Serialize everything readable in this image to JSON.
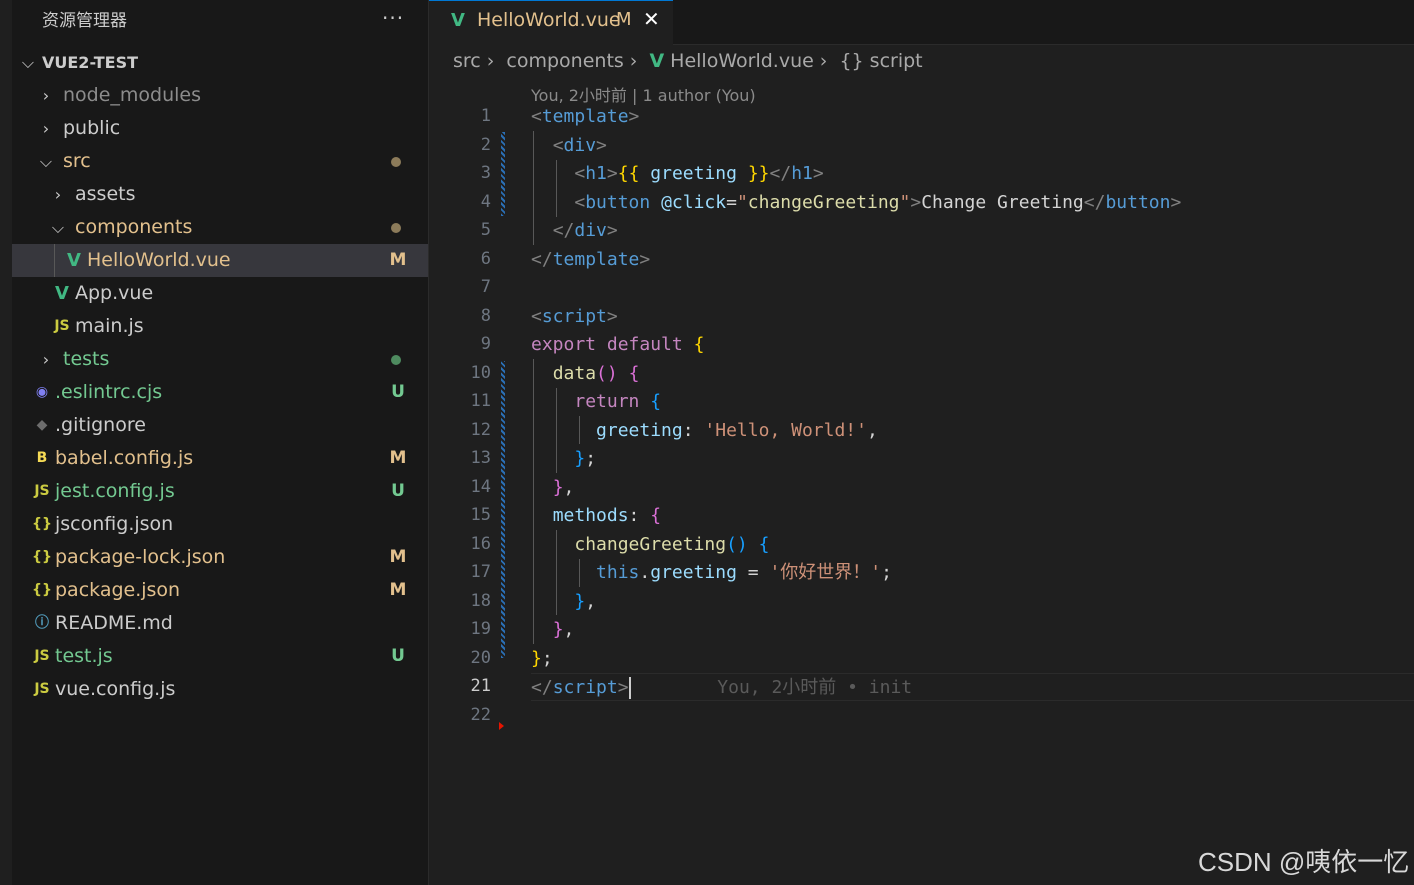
{
  "explorer": {
    "title": "资源管理器",
    "more": "···",
    "project": "VUE2-TEST",
    "items": [
      {
        "label": "node_modules",
        "kind": "folder",
        "state": "collapsed",
        "color": "#8c8c8c",
        "icon": "chevron-right-icon"
      },
      {
        "label": "public",
        "kind": "folder",
        "state": "collapsed",
        "color": "#cccccc",
        "icon": "chevron-right-icon"
      },
      {
        "label": "src",
        "kind": "folder",
        "state": "expanded",
        "color": "#e2c08d",
        "icon": "chevron-down-icon",
        "dot": "#8c7b5a"
      },
      {
        "label": "assets",
        "kind": "folder",
        "state": "collapsed",
        "color": "#cccccc",
        "icon": "chevron-right-icon"
      },
      {
        "label": "components",
        "kind": "folder",
        "state": "expanded",
        "color": "#e2c08d",
        "icon": "chevron-down-icon",
        "dot": "#8c7b5a"
      },
      {
        "label": "HelloWorld.vue",
        "kind": "file",
        "color": "#e2c08d",
        "icon": "vue-icon",
        "badge": "M",
        "badgeColor": "#e2c08d"
      },
      {
        "label": "App.vue",
        "kind": "file",
        "color": "#cccccc",
        "icon": "vue-icon"
      },
      {
        "label": "main.js",
        "kind": "file",
        "color": "#cccccc",
        "icon": "js-icon"
      },
      {
        "label": "tests",
        "kind": "folder",
        "state": "collapsed",
        "color": "#73c991",
        "icon": "chevron-right-icon",
        "dot": "#4e8b5f"
      },
      {
        "label": ".eslintrc.cjs",
        "kind": "file",
        "color": "#73c991",
        "icon": "eslint-icon",
        "badge": "U",
        "badgeColor": "#73c991"
      },
      {
        "label": ".gitignore",
        "kind": "file",
        "color": "#cccccc",
        "icon": "git-icon"
      },
      {
        "label": "babel.config.js",
        "kind": "file",
        "color": "#e2c08d",
        "icon": "babel-icon",
        "badge": "M",
        "badgeColor": "#e2c08d"
      },
      {
        "label": "jest.config.js",
        "kind": "file",
        "color": "#73c991",
        "icon": "js-icon",
        "badge": "U",
        "badgeColor": "#73c991"
      },
      {
        "label": "jsconfig.json",
        "kind": "file",
        "color": "#cccccc",
        "icon": "json-icon"
      },
      {
        "label": "package-lock.json",
        "kind": "file",
        "color": "#e2c08d",
        "icon": "json-icon",
        "badge": "M",
        "badgeColor": "#e2c08d"
      },
      {
        "label": "package.json",
        "kind": "file",
        "color": "#e2c08d",
        "icon": "json-icon",
        "badge": "M",
        "badgeColor": "#e2c08d"
      },
      {
        "label": "README.md",
        "kind": "file",
        "color": "#cccccc",
        "icon": "info-icon"
      },
      {
        "label": "test.js",
        "kind": "file",
        "color": "#73c991",
        "icon": "js-icon",
        "badge": "U",
        "badgeColor": "#73c991"
      },
      {
        "label": "vue.config.js",
        "kind": "file",
        "color": "#cccccc",
        "icon": "js-icon"
      }
    ]
  },
  "tab": {
    "name": "HelloWorld.vue",
    "status": "M",
    "close": "✕"
  },
  "breadcrumb": {
    "parts": [
      "src",
      "components",
      "HelloWorld.vue",
      "{} script"
    ]
  },
  "blame": {
    "header": "You, 2小时前 | 1 author (You)",
    "inline": "You, 2小时前 • init"
  },
  "editor": {
    "active_line": 21,
    "line_count": 22
  },
  "watermark": "CSDN @咦依一忆",
  "colors": {
    "accent": "#0078d4",
    "modified": "#e2c08d",
    "untracked": "#73c991",
    "vue": "#41b883"
  }
}
